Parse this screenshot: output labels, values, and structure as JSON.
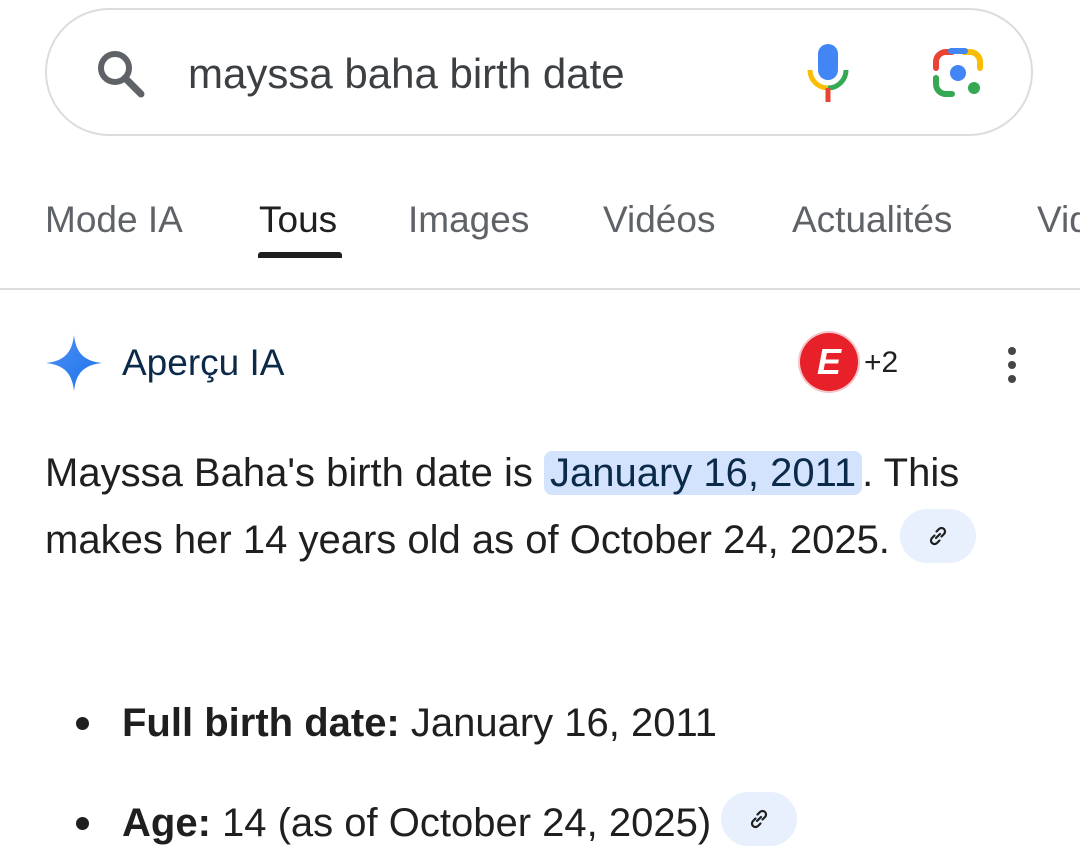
{
  "search": {
    "query": "mayssa baha birth date"
  },
  "tabs": [
    {
      "label": "Mode IA"
    },
    {
      "label": "Tous"
    },
    {
      "label": "Images"
    },
    {
      "label": "Vidéos"
    },
    {
      "label": "Actualités"
    },
    {
      "label": "Vid"
    }
  ],
  "ai_overview": {
    "title": "Aperçu IA",
    "source_count": "+2",
    "summary": {
      "before": "Mayssa Baha's birth date is ",
      "highlight": "January 16, 2011",
      "after": ". This makes her 14 years old as of October 24, 2025."
    },
    "bullets": [
      {
        "label": "Full birth date:",
        "value": " January 16, 2011"
      },
      {
        "label": "Age:",
        "value": " 14 (as of October 24, 2025)"
      }
    ]
  },
  "colors": {
    "highlight": "#d3e3fd",
    "source_badge": "#e8202a",
    "active_tab_underline": "#1f1f1f"
  },
  "icons": [
    "search-icon",
    "mic-icon",
    "lens-icon",
    "sparkle-icon",
    "more-vert-icon",
    "link-icon"
  ]
}
